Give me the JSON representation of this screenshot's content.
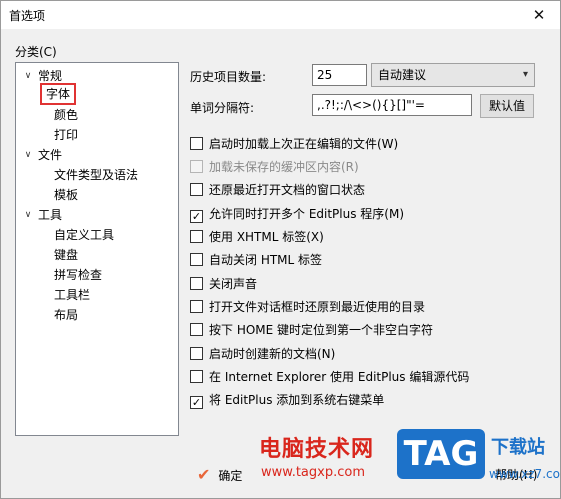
{
  "window": {
    "title": "首选项",
    "close_glyph": "✕"
  },
  "sidebar": {
    "group_label": "分类(C)",
    "items": [
      {
        "label": "常规",
        "arrow": "∨"
      },
      {
        "label": "字体"
      },
      {
        "label": "颜色"
      },
      {
        "label": "打印"
      },
      {
        "label": "文件",
        "arrow": "∨"
      },
      {
        "label": "文件类型及语法"
      },
      {
        "label": "模板"
      },
      {
        "label": "工具",
        "arrow": "∨"
      },
      {
        "label": "自定义工具"
      },
      {
        "label": "键盘"
      },
      {
        "label": "拼写检查"
      },
      {
        "label": "工具栏"
      },
      {
        "label": "布局"
      }
    ]
  },
  "form": {
    "history_label": "历史项目数量:",
    "history_value": "25",
    "history_select": "自动建议",
    "word_sep_label": "单词分隔符:",
    "word_sep_value": ",.?!;:/\\<>(){}[]\"'=",
    "default_button": "默认值"
  },
  "options": [
    {
      "label": "启动时加载上次正在编辑的文件(W)",
      "checked": false,
      "disabled": false
    },
    {
      "label": "加载未保存的缓冲区内容(R)",
      "checked": false,
      "disabled": true
    },
    {
      "label": "还原最近打开文档的窗口状态",
      "checked": false,
      "disabled": false
    },
    {
      "label": "允许同时打开多个 EditPlus 程序(M)",
      "checked": true,
      "disabled": false
    },
    {
      "label": "使用 XHTML 标签(X)",
      "checked": false,
      "disabled": false
    },
    {
      "label": "自动关闭 HTML 标签",
      "checked": false,
      "disabled": false
    },
    {
      "label": "关闭声音",
      "checked": false,
      "disabled": false
    },
    {
      "label": "打开文件对话框时还原到最近使用的目录",
      "checked": false,
      "disabled": false
    },
    {
      "label": "按下 HOME 键时定位到第一个非空白字符",
      "checked": false,
      "disabled": false
    },
    {
      "label": "启动时创建新的文档(N)",
      "checked": false,
      "disabled": false
    },
    {
      "label": "在 Internet Explorer 使用 EditPlus 编辑源代码",
      "checked": false,
      "disabled": false
    },
    {
      "label": "将 EditPlus 添加到系统右键菜单",
      "checked": true,
      "disabled": false
    }
  ],
  "footer": {
    "ok_label": "确定",
    "help_label": "帮助(H)"
  },
  "watermark": {
    "site_cn": "电脑技术网",
    "site_url": "www.tagxp.com",
    "tag": "TAG",
    "right_cn": "下载站",
    "right_url": "www.xz7.com"
  },
  "colors": {
    "selection_outline": "#e03333",
    "watermark_red": "#d9261c",
    "watermark_blue": "#1d72c9"
  }
}
